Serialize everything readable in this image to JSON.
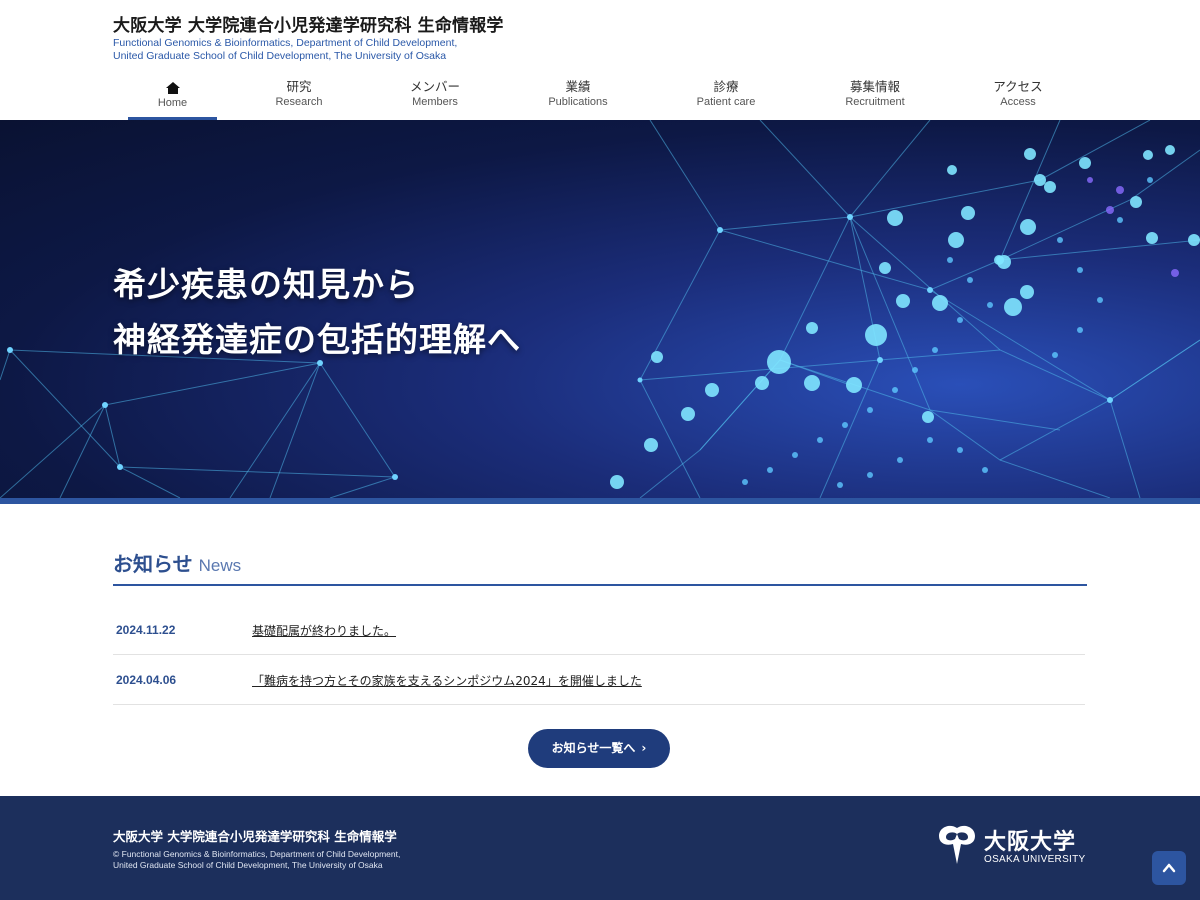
{
  "header": {
    "title": "大阪大学 大学院連合小児発達学研究科 生命情報学",
    "subtitle_line1": "Functional Genomics & Bioinformatics, Department of Child Development,",
    "subtitle_line2": "United Graduate School of Child Development, The University of Osaka"
  },
  "nav": [
    {
      "jp": "",
      "en": "Home",
      "icon": "home-icon",
      "active": true
    },
    {
      "jp": "研究",
      "en": "Research"
    },
    {
      "jp": "メンバー",
      "en": "Members"
    },
    {
      "jp": "業績",
      "en": "Publications"
    },
    {
      "jp": "診療",
      "en": "Patient care"
    },
    {
      "jp": "募集情報",
      "en": "Recruitment"
    },
    {
      "jp": "アクセス",
      "en": "Access"
    }
  ],
  "hero": {
    "line1": "希少疾患の知見から",
    "line2": "神経発達症の包括的理解へ"
  },
  "news": {
    "title_jp": "お知らせ",
    "title_en": "News",
    "items": [
      {
        "date": "2024.11.22",
        "text": "基礎配属が終わりました。"
      },
      {
        "date": "2024.04.06",
        "text": "「難病を持つ方とその家族を支えるシンポジウム2024」を開催しました"
      }
    ],
    "more_label": "お知らせ一覧へ"
  },
  "footer": {
    "title": "大阪大学 大学院連合小児発達学研究科 生命情報学",
    "copy_line1": "© Functional Genomics & Bioinformatics, Department of Child Development,",
    "copy_line2": "United Graduate School of Child Development, The University of Osaka",
    "logo_jp": "大阪大学",
    "logo_en": "OSAKA UNIVERSITY"
  },
  "colors": {
    "accent": "#2d55a0",
    "footer_bg": "#1c2f5c",
    "button_bg": "#1f3c7c"
  }
}
